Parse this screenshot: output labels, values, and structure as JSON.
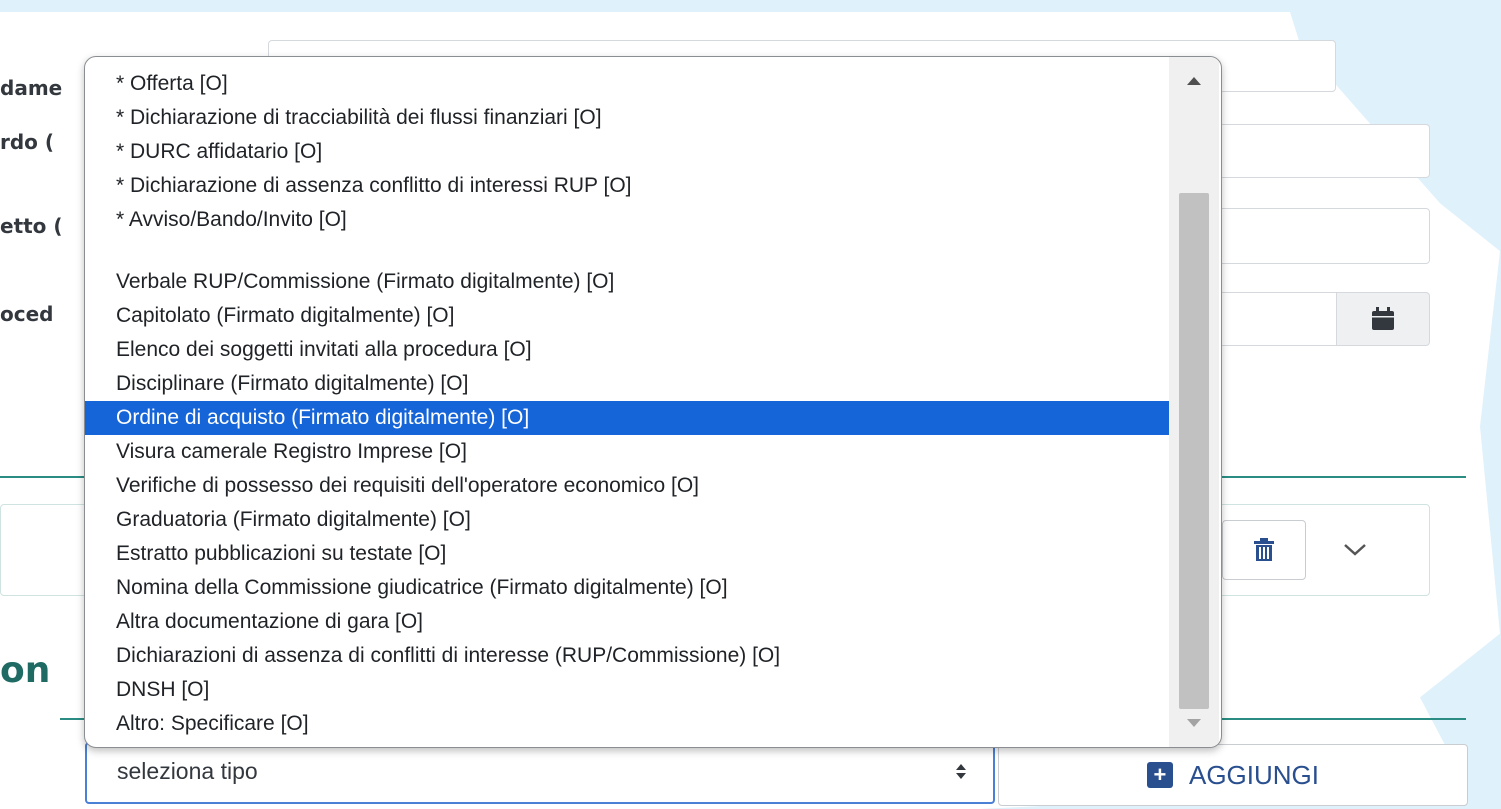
{
  "background_form": {
    "label_fragments": [
      "dame",
      "rdo (",
      "etto (",
      "oced"
    ],
    "section_fragment": "on",
    "type_select": {
      "value": "seleziona tipo"
    },
    "add_button": {
      "label": "AGGIUNGI"
    }
  },
  "dropdown": {
    "required_options": [
      "* Offerta [O]",
      "* Dichiarazione di tracciabilità dei flussi finanziari [O]",
      "* DURC affidatario [O]",
      "* Dichiarazione di assenza conflitto di interessi RUP [O]",
      "* Avviso/Bando/Invito [O]"
    ],
    "options": [
      "Verbale RUP/Commissione (Firmato digitalmente) [O]",
      "Capitolato (Firmato digitalmente) [O]",
      "Elenco dei soggetti invitati alla procedura [O]",
      "Disciplinare (Firmato digitalmente) [O]",
      "Ordine di acquisto (Firmato digitalmente) [O]",
      "Visura camerale Registro Imprese [O]",
      "Verifiche di possesso dei requisiti dell'operatore economico [O]",
      "Graduatoria (Firmato digitalmente) [O]",
      "Estratto pubblicazioni su testate [O]",
      "Nomina della Commissione giudicatrice (Firmato digitalmente) [O]",
      "Altra documentazione di gara [O]",
      "Dichiarazioni di assenza di conflitti di interesse (RUP/Commissione) [O]",
      "DNSH [O]",
      "Altro: Specificare [O]"
    ],
    "selected_option": "Ordine di acquisto (Firmato digitalmente) [O]",
    "scroll_position": 0.85
  },
  "colors": {
    "selection": "#1565d8",
    "accent_teal": "#2a8c83",
    "primary_blue": "#2a4f8f"
  },
  "icons": [
    "calendar-icon",
    "trash-icon",
    "chevron-down-icon",
    "plus-square-icon",
    "scroll-up-icon",
    "scroll-down-icon",
    "sort-arrows-icon"
  ]
}
